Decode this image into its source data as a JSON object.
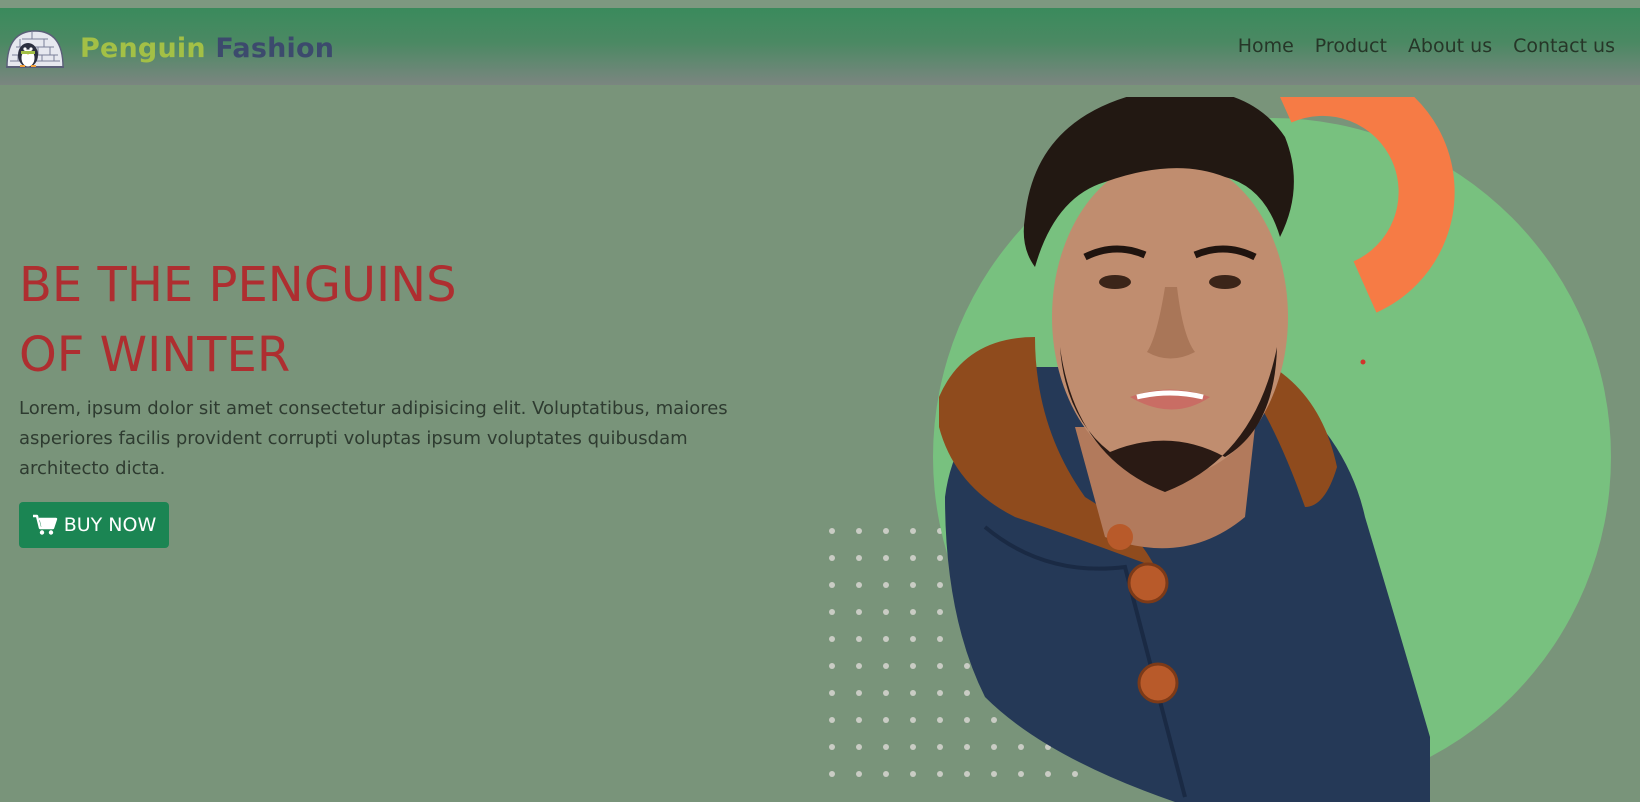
{
  "brand": {
    "name_part1": "Penguin",
    "name_part2": "Fashion",
    "logo_icon": "igloo-penguin-logo"
  },
  "nav": {
    "items": [
      "Home",
      "Product",
      "About us",
      "Contact us"
    ]
  },
  "hero": {
    "title_line1": "BE THE PENGUINS",
    "title_line2": "OF WINTER",
    "description": "Lorem, ipsum dolor sit amet consectetur adipisicing elit. Voluptatibus, maiores asperiores facilis provident corrupti voluptas ipsum voluptates quibusdam architecto dicta.",
    "button_label": "BUY NOW",
    "button_icon": "cart-icon",
    "image_subject": "model-photo"
  },
  "colors": {
    "page_bg": "#79947a",
    "navbar_green": "#3a8a5c",
    "brand_yellow_green": "#a3c046",
    "brand_navy": "#3c4a6d",
    "title_red": "#ae2e30",
    "button_green": "#1b8553",
    "circle_green": "#78c17f",
    "accent_orange": "#f67b45"
  }
}
